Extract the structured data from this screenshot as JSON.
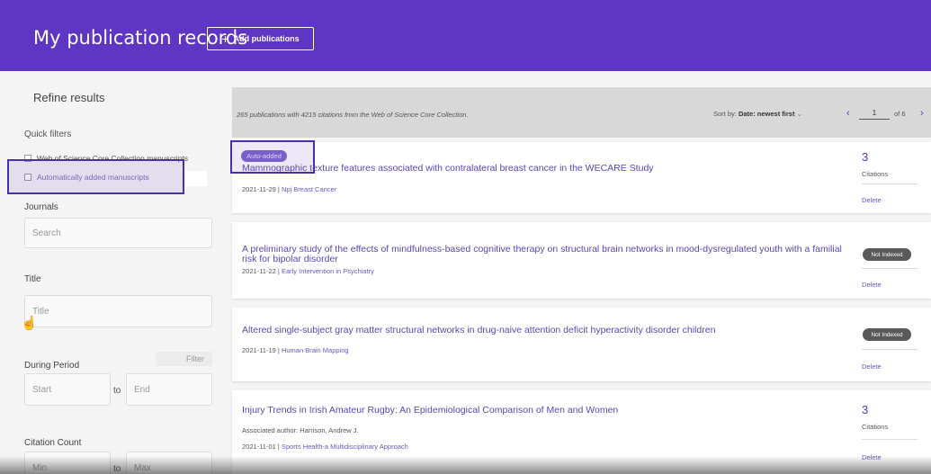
{
  "header": {
    "title": "My publication records",
    "add_label": "Add publications",
    "add_icon": "plus-icon",
    "bg_color": "#5f35c4"
  },
  "sidebar": {
    "refine_title": "Refine results",
    "quick_filters_label": "Quick filters",
    "filters": [
      "Web of Science Core Collection manuscripts",
      "Automatically added manuscripts"
    ],
    "journals_label": "Journals",
    "journals_placeholder": "Search",
    "title_label": "Title",
    "title_placeholder": "Title",
    "period_label": "During Period",
    "start_placeholder": "Start",
    "to_label": "to",
    "end_placeholder": "End",
    "filter_button": "Filter",
    "citation_label": "Citation Count",
    "min_placeholder": "Min",
    "max_placeholder": "Max"
  },
  "results_bar": {
    "summary": "265 publications with 4215 citations from the Web of Science Core Collection.",
    "sort_label": "Sort by:",
    "sort_value": "Date: newest first",
    "page": "1",
    "of_pages": "of 6"
  },
  "publications": [
    {
      "badge": "Auto-added",
      "title": "Mammographic texture features associated with contralateral breast cancer in the WECARE Study",
      "date": "2021-11-29",
      "journal": "Npj Breast Cancer",
      "citations": "3",
      "citations_label": "Citations",
      "delete_label": "Delete"
    },
    {
      "title": "A preliminary study of the effects of mindfulness-based cognitive therapy on structural brain networks in mood-dysregulated youth with a familial risk for bipolar disorder",
      "date": "2021-11-22",
      "journal": "Early Intervention in Psychiatry",
      "status": "Not Indexed",
      "delete_label": "Delete"
    },
    {
      "title": "Altered single-subject gray matter structural networks in drug-naive attention deficit hyperactivity disorder children",
      "date": "2021-11-19",
      "journal": "Human Brain Mapping",
      "status": "Not Indexed",
      "delete_label": "Delete"
    },
    {
      "title": "Injury Trends in Irish Amateur Rugby: An Epidemiological Comparison of Men and Women",
      "author": "Associated author: Harrison, Andrew J.",
      "date": "2021-11-01",
      "journal": "Sports Health-a Multidisciplinary Approach",
      "citations": "3",
      "citations_label": "Citations",
      "delete_label": "Delete"
    }
  ],
  "separator": " | "
}
